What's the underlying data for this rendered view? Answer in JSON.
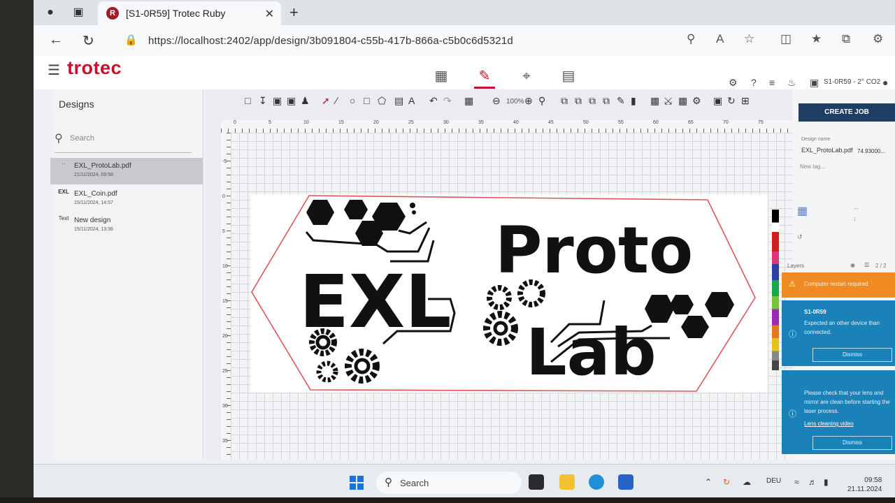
{
  "browser": {
    "tab_title": "[S1-0R59] Trotec Ruby",
    "tab_favicon_letter": "R",
    "url": "https://localhost:2402/app/design/3b091804-c55b-417b-866a-c5b0c6d5321d"
  },
  "app": {
    "logo": "trotec",
    "device_label": "S1-0R59 - 2° CO2",
    "modes": [
      "grid-icon",
      "design-edit-icon",
      "prepare-icon",
      "job-icon"
    ],
    "active_mode": "design-edit-icon"
  },
  "designs_panel": {
    "title": "Designs",
    "search_placeholder": "Search",
    "items": [
      {
        "thumb": "··",
        "name": "EXL_ProtoLab.pdf",
        "date": "21/11/2024, 09:58"
      },
      {
        "thumb": "EXL",
        "name": "EXL_Coin.pdf",
        "date": "15/11/2024, 14:57"
      },
      {
        "thumb": "Text",
        "name": "New design",
        "date": "15/11/2024, 13:36"
      }
    ]
  },
  "toolbar": {
    "zoom": "100%"
  },
  "rulers": {
    "h_labels": [
      "0",
      "5",
      "10",
      "15",
      "20",
      "25",
      "30",
      "35",
      "40",
      "45",
      "50",
      "55",
      "60",
      "65",
      "70",
      "75"
    ],
    "v_labels": [
      "-5",
      "0",
      "5",
      "10",
      "15",
      "20",
      "25",
      "30",
      "35"
    ]
  },
  "design": {
    "word_left": "EXL",
    "word_right_top": "Proto",
    "word_right_bottom": "Lab",
    "outline_color": "#e0545c"
  },
  "right_panel": {
    "create_job": "CREATE JOB",
    "design_name_label": "Design name",
    "design_name": "EXL_ProtoLab.pdf",
    "width_value": "74.93000...",
    "new_tag": "New tag...",
    "layers_label": "Layers",
    "layers_count": "2 / 2",
    "notifications": [
      {
        "type": "warning",
        "title": "Computer restart required"
      },
      {
        "type": "info",
        "title": "S1-0R59",
        "message": "Expected an other device than connected.",
        "button": "Dismiss"
      },
      {
        "type": "info",
        "message": "Please check that your lens and mirror are clean before starting the laser process.",
        "link": "Lens cleaning video",
        "button": "Dismiss"
      }
    ]
  },
  "taskbar": {
    "search": "Search",
    "language": "DEU",
    "time": "09:58",
    "date": "21.11.2024"
  }
}
